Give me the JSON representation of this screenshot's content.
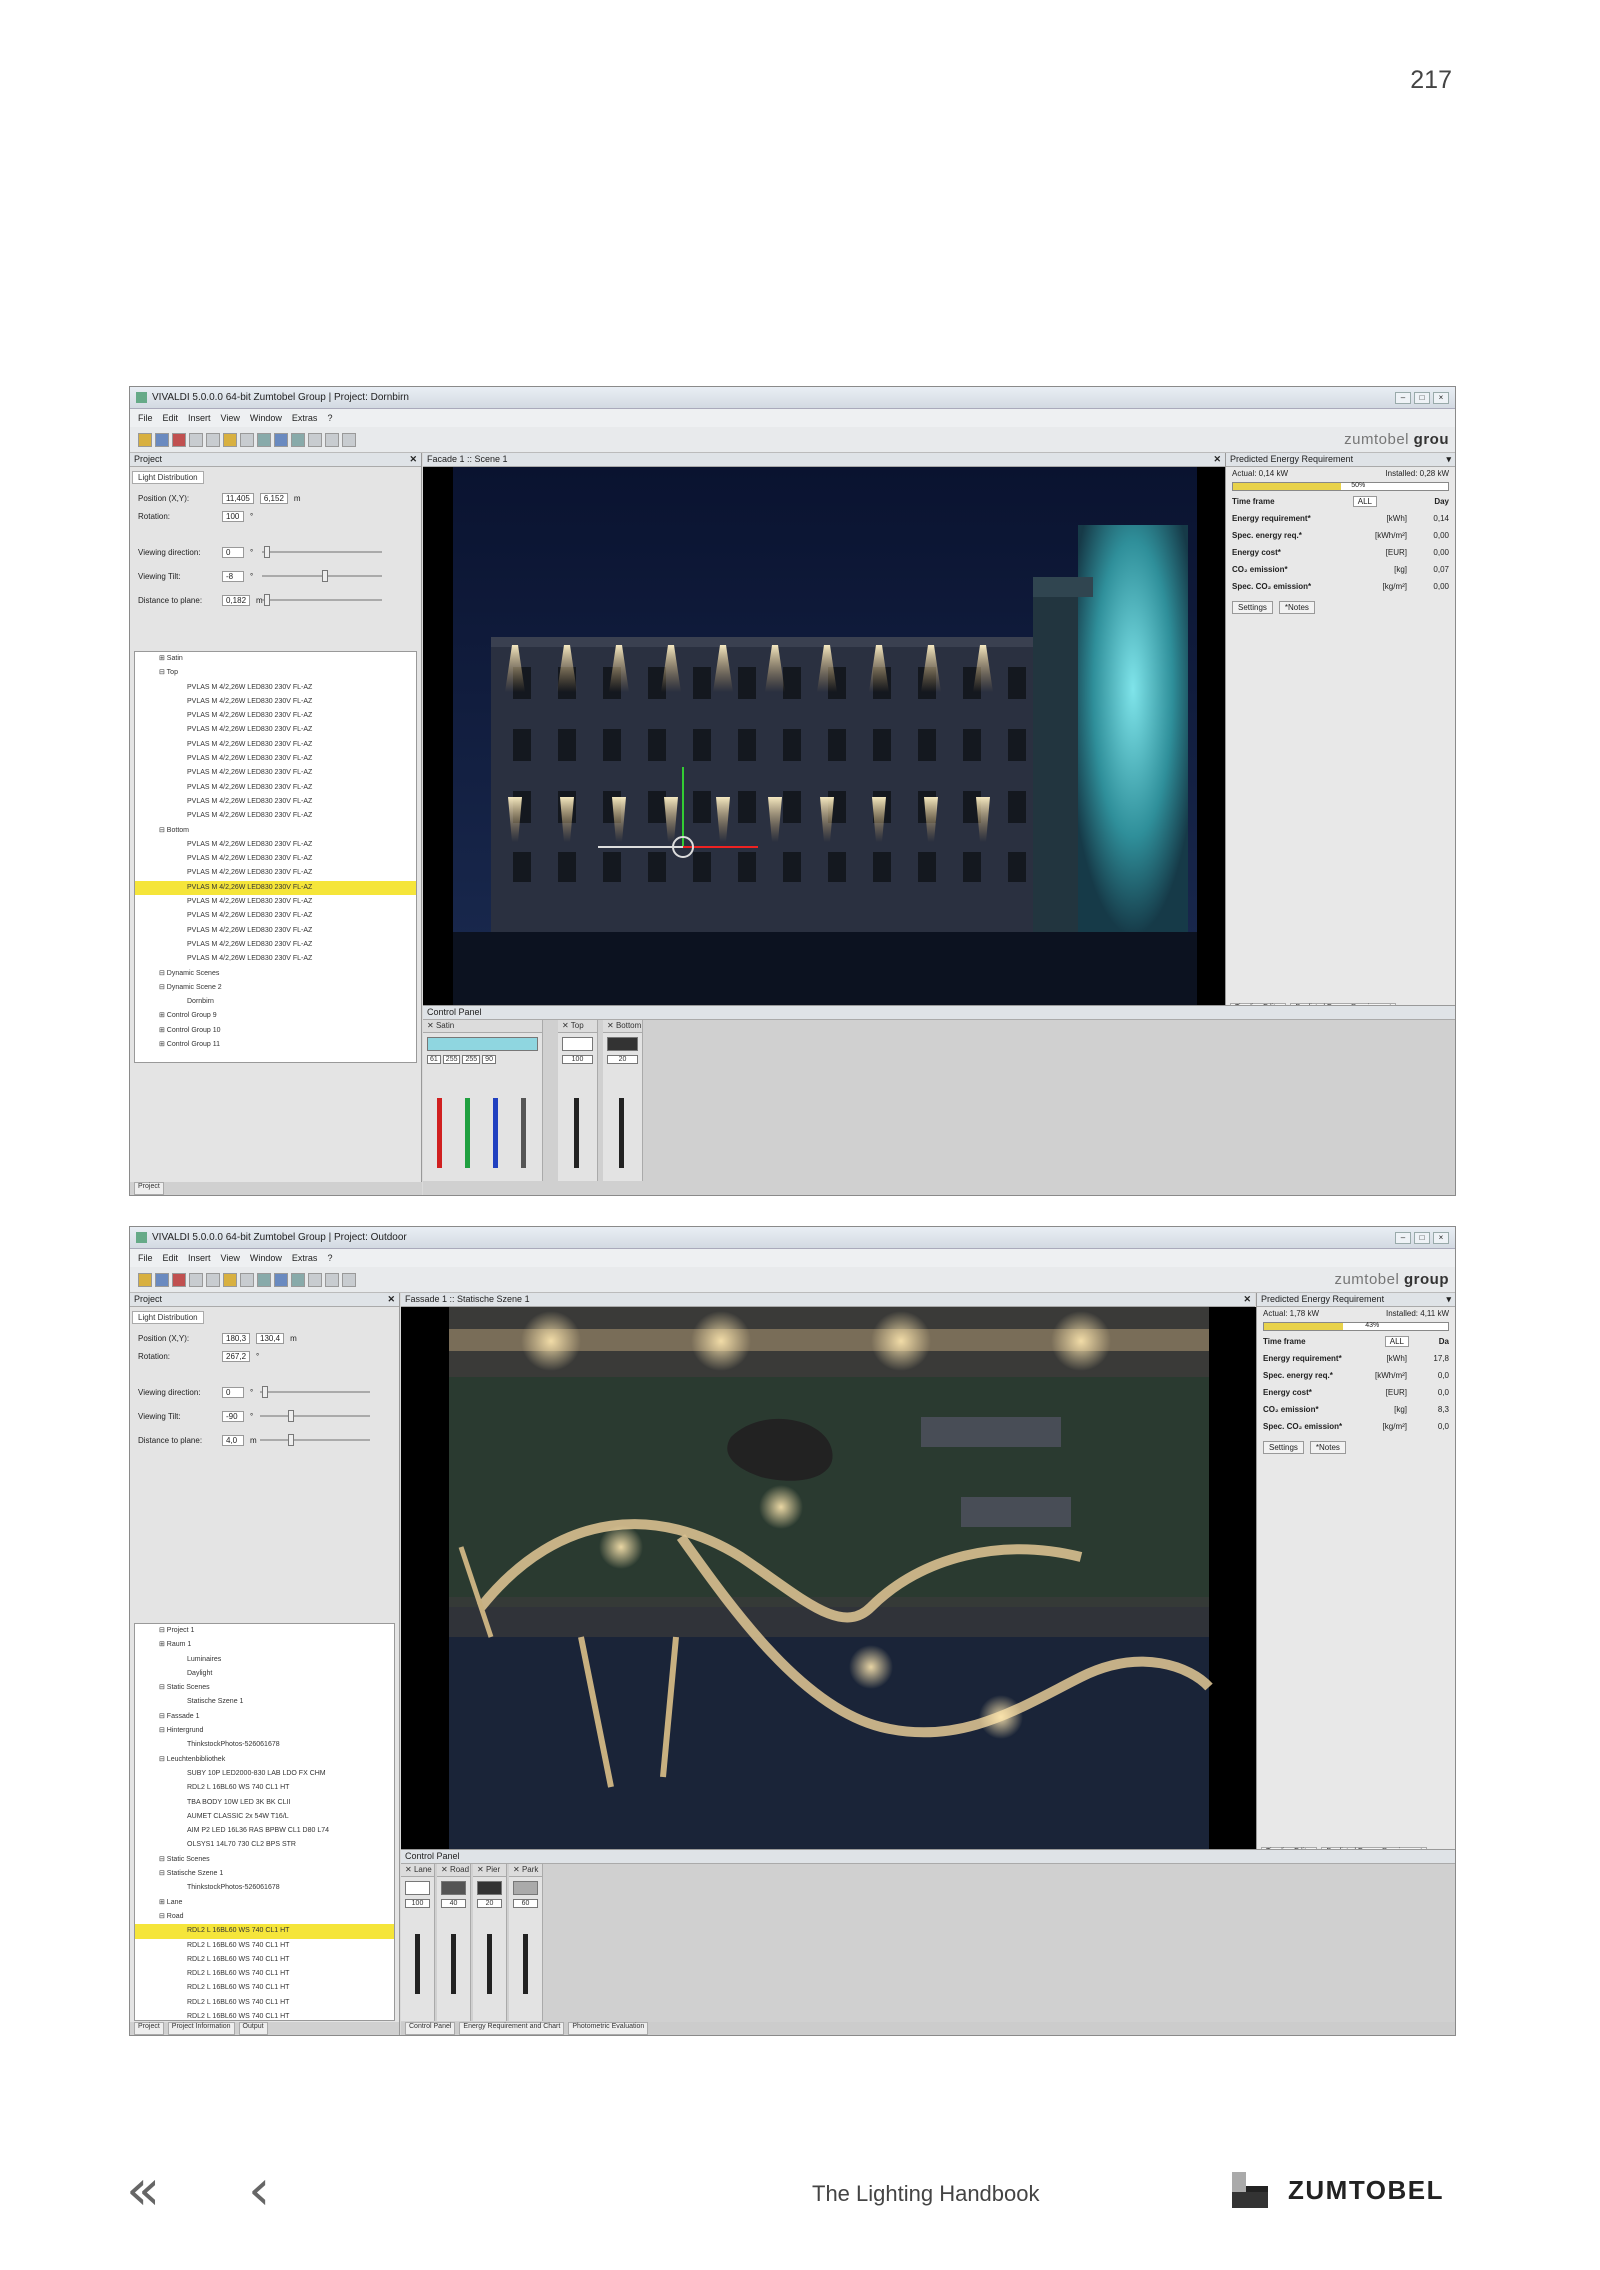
{
  "page_number": "217",
  "footer": {
    "handbook": "The Lighting Handbook",
    "brand": "ZUMTOBEL",
    "nav_first": "«",
    "nav_prev": "‹"
  },
  "shot1": {
    "title": "VIVALDI 5.0.0.0 64-bit Zumtobel Group | Project: Dornbirn",
    "menu": [
      "File",
      "Edit",
      "Insert",
      "View",
      "Window",
      "Extras",
      "?"
    ],
    "logo": "zumtobel",
    "logo_bold": "grou",
    "left_head": "Project",
    "ld_tab": "Light Distribution",
    "fields": {
      "position_label": "Position (X,Y):",
      "pos_x": "11,405",
      "pos_y": "6,152",
      "pos_unit": "m",
      "rotation_label": "Rotation:",
      "rotation": "100",
      "viewdir_label": "Viewing direction:",
      "viewdir": "0",
      "tilt_label": "Viewing Tilt:",
      "tilt": "-8",
      "dist_label": "Distance to plane:",
      "dist": "0,182",
      "dist_unit": "m"
    },
    "tree": [
      "⊞ Satin",
      "⊟ Top",
      "PVLAS M 4/2,26W LED830 230V FL-AZ",
      "PVLAS M 4/2,26W LED830 230V FL-AZ",
      "PVLAS M 4/2,26W LED830 230V FL-AZ",
      "PVLAS M 4/2,26W LED830 230V FL-AZ",
      "PVLAS M 4/2,26W LED830 230V FL-AZ",
      "PVLAS M 4/2,26W LED830 230V FL-AZ",
      "PVLAS M 4/2,26W LED830 230V FL-AZ",
      "PVLAS M 4/2,26W LED830 230V FL-AZ",
      "PVLAS M 4/2,26W LED830 230V FL-AZ",
      "PVLAS M 4/2,26W LED830 230V FL-AZ",
      "⊟ Bottom",
      "PVLAS M 4/2,26W LED830 230V FL-AZ",
      "PVLAS M 4/2,26W LED830 230V FL-AZ",
      "PVLAS M 4/2,26W LED830 230V FL-AZ",
      "PVLAS M 4/2,26W LED830 230V FL-AZ",
      "PVLAS M 4/2,26W LED830 230V FL-AZ",
      "PVLAS M 4/2,26W LED830 230V FL-AZ",
      "PVLAS M 4/2,26W LED830 230V FL-AZ",
      "PVLAS M 4/2,26W LED830 230V FL-AZ",
      "PVLAS M 4/2,26W LED830 230V FL-AZ",
      "⊟ Dynamic Scenes",
      "⊟ Dynamic Scene 2",
      "Dornbirn",
      "⊞ Control Group 9",
      "⊞ Control Group 10",
      "⊞ Control Group 11"
    ],
    "tree_highlight": 16,
    "view_head": "Facade 1 :: Scene 1",
    "energy_head": "Predicted Energy Requirement",
    "actual": "Actual: 0,14 kW",
    "installed": "Installed: 0,28 kW",
    "bar_pct": 50,
    "bar_label": "50%",
    "time_frame_label": "Time frame",
    "time_frame": "ALL",
    "col_day": "Day",
    "energy_rows": [
      {
        "name": "Energy requirement*",
        "unit": "[kWh]",
        "value": "0,14"
      },
      {
        "name": "Spec. energy req.*",
        "unit": "[kWh/m²]",
        "value": "0,00"
      },
      {
        "name": "Energy cost*",
        "unit": "[EUR]",
        "value": "0,00"
      },
      {
        "name": "CO₂ emission*",
        "unit": "[kg]",
        "value": "0,07"
      },
      {
        "name": "Spec. CO₂ emission*",
        "unit": "[kg/m²]",
        "value": "0,00"
      }
    ],
    "btn_settings": "Settings",
    "btn_notes": "*Notes",
    "rtabs": [
      "Timeline Editor",
      "Predicted Energy Requirement"
    ],
    "ctrl_head": "Control Panel",
    "channels": [
      "Satin",
      "Top",
      "Bottom"
    ],
    "rgb_values": [
      "61",
      "255",
      "255",
      "90"
    ],
    "top_value": "100",
    "bottom_value": "20",
    "bottom_tabs": [
      "Project",
      "Control Panel"
    ]
  },
  "shot2": {
    "title": "VIVALDI 5.0.0.0 64-bit Zumtobel Group | Project: Outdoor",
    "menu": [
      "File",
      "Edit",
      "Insert",
      "View",
      "Window",
      "Extras",
      "?"
    ],
    "logo": "zumtobel",
    "logo_bold": "group",
    "left_head": "Project",
    "ld_tab": "Light Distribution",
    "fields": {
      "position_label": "Position (X,Y):",
      "pos_x": "180,3",
      "pos_y": "130,4",
      "pos_unit": "m",
      "rotation_label": "Rotation:",
      "rotation": "267,2",
      "viewdir_label": "Viewing direction:",
      "viewdir": "0",
      "tilt_label": "Viewing Tilt:",
      "tilt": "-90",
      "dist_label": "Distance to plane:",
      "dist": "4,0",
      "dist_unit": "m"
    },
    "tree": [
      "⊟ Project 1",
      "⊞ Raum 1",
      "Luminaires",
      "Daylight",
      "⊟ Static Scenes",
      "Statische Szene 1",
      "⊟ Fassade 1",
      "⊟ Hintergrund",
      "ThinkstockPhotos-526061678",
      "⊟ Leuchtenbibliothek",
      "SUBY 10P LED2000-830 LAB LDO FX CHM",
      "RDL2 L 16BL60 WS 740 CL1 HT",
      "TBA BODY 10W LED 3K BK CLII",
      "AUMET CLASSIC 2x 54W T16/L",
      "AIM P2 LED 16L36 RAS BPBW CL1 D80 L74",
      "OLSYS1 14L70 730 CL2 BPS STR",
      "⊟ Static Scenes",
      "⊟ Statische Szene 1",
      "ThinkstockPhotos-526061678",
      "⊞ Lane",
      "⊟ Road",
      "RDL2 L 16BL60 WS 740 CL1 HT",
      "RDL2 L 16BL60 WS 740 CL1 HT",
      "RDL2 L 16BL60 WS 740 CL1 HT",
      "RDL2 L 16BL60 WS 740 CL1 HT",
      "RDL2 L 16BL60 WS 740 CL1 HT",
      "RDL2 L 16BL60 WS 740 CL1 HT",
      "RDL2 L 16BL60 WS 740 CL1 HT"
    ],
    "tree_highlight": 21,
    "view_head": "Fassade 1 :: Statische Szene 1",
    "energy_head": "Predicted Energy Requirement",
    "actual": "Actual: 1,78 kW",
    "installed": "Installed: 4,11 kW",
    "bar_pct": 43,
    "bar_label": "43%",
    "time_frame_label": "Time frame",
    "time_frame": "ALL",
    "col_day": "Da",
    "energy_rows": [
      {
        "name": "Energy requirement*",
        "unit": "[kWh]",
        "value": "17,8"
      },
      {
        "name": "Spec. energy req.*",
        "unit": "[kWh/m²]",
        "value": "0,0"
      },
      {
        "name": "Energy cost*",
        "unit": "[EUR]",
        "value": "0,0"
      },
      {
        "name": "CO₂ emission*",
        "unit": "[kg]",
        "value": "8,3"
      },
      {
        "name": "Spec. CO₂ emission*",
        "unit": "[kg/m²]",
        "value": "0,0"
      }
    ],
    "btn_settings": "Settings",
    "btn_notes": "*Notes",
    "rtabs": [
      "Timeline Editor",
      "Predicted Energy Requirement"
    ],
    "ctrl_head": "Control Panel",
    "channels": [
      "Lane",
      "Road",
      "Pier",
      "Park"
    ],
    "channel_values": [
      "100",
      "40",
      "20",
      "60"
    ],
    "bottom_tabs": [
      "Project",
      "Project Information",
      "Output"
    ],
    "ctrl_tabs": [
      "Control Panel",
      "Energy Requirement and Chart",
      "Photometric Evaluation"
    ]
  }
}
